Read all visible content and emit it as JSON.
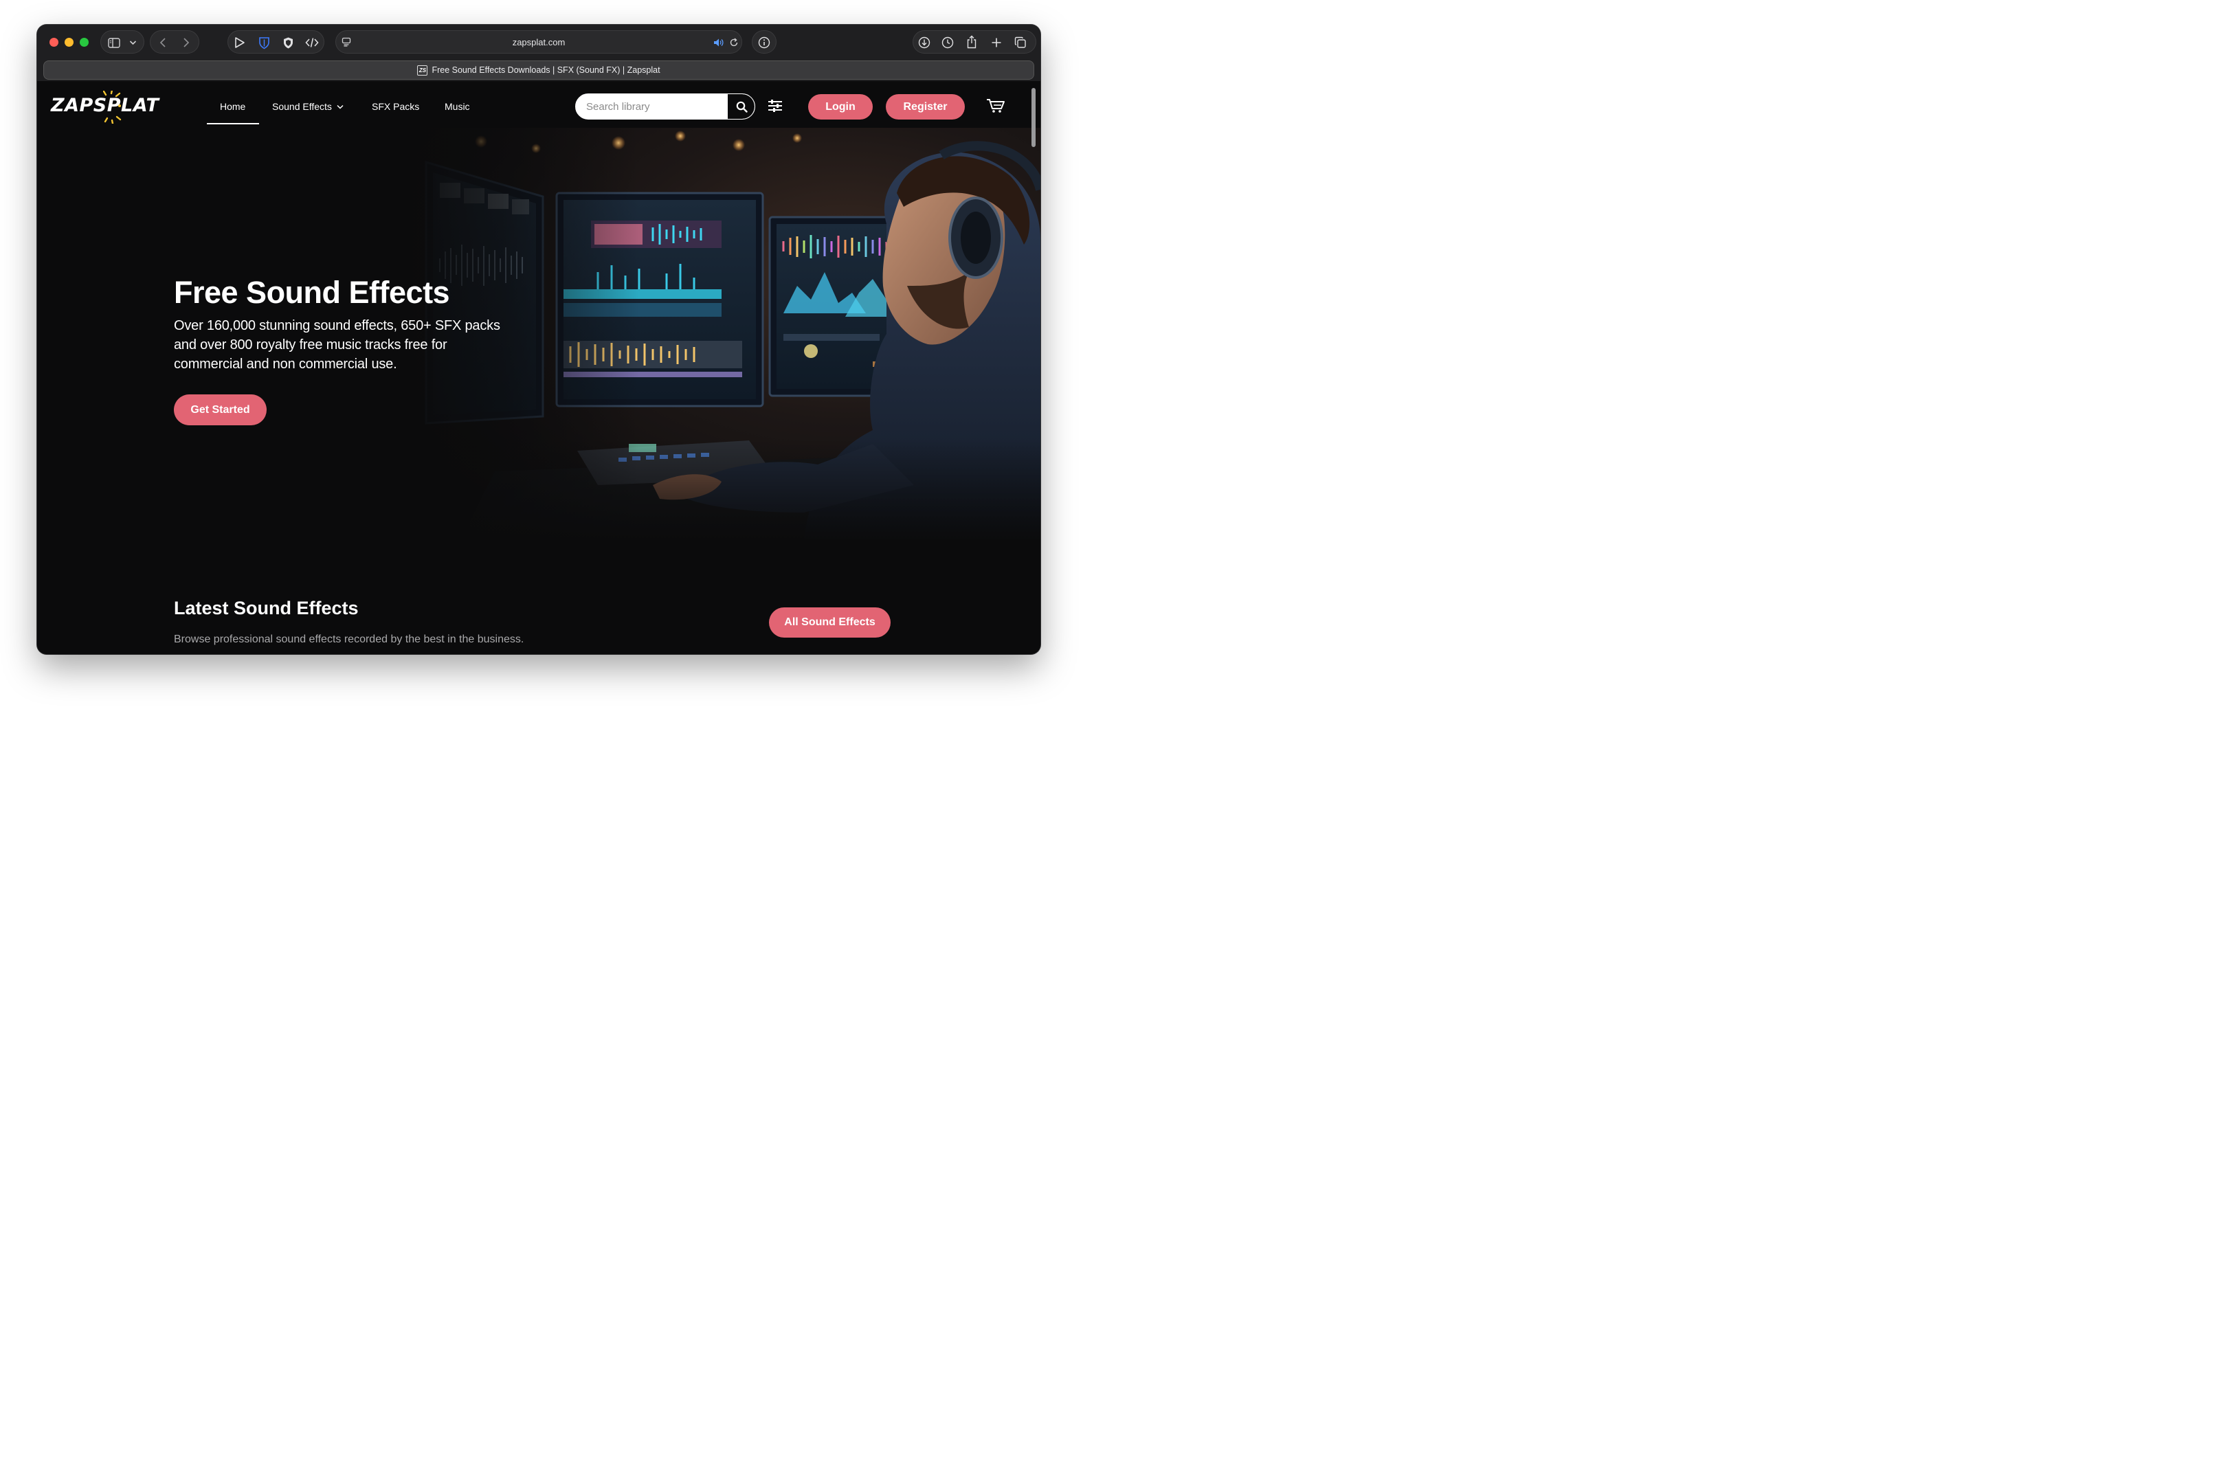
{
  "browser": {
    "url": "zapsplat.com",
    "tab_title": "Free Sound Effects Downloads | SFX (Sound FX) | Zapsplat",
    "favicon_text": "ZS",
    "toolbar_icons": [
      "sidebar-icon",
      "chevron-down-icon",
      "back-icon",
      "forward-icon",
      "play-icon",
      "bitwarden-shield-icon",
      "shield-icon",
      "code-icon",
      "reader-icon",
      "speaker-icon",
      "reload-icon",
      "info-icon",
      "download-icon",
      "history-icon",
      "share-icon",
      "plus-icon",
      "tabs-icon"
    ]
  },
  "site": {
    "logo": "ZAPSPLAT",
    "nav": {
      "home": "Home",
      "sound_effects": "Sound Effects",
      "sfx_packs": "SFX Packs",
      "music": "Music"
    },
    "search": {
      "placeholder": "Search library"
    },
    "login": "Login",
    "register": "Register",
    "hero": {
      "title": "Free Sound Effects",
      "subtitle": "Over 160,000 stunning sound effects, 650+ SFX packs and over 800 royalty free music tracks free for commercial and non commercial use.",
      "cta": "Get Started"
    },
    "latest": {
      "title": "Latest Sound Effects",
      "subtitle": "Browse professional sound effects recorded by the best in the business.",
      "button": "All Sound Effects"
    }
  },
  "colors": {
    "accent_pink": "#e26473",
    "background": "#0b0b0c",
    "toolbar": "#1f1f21"
  }
}
